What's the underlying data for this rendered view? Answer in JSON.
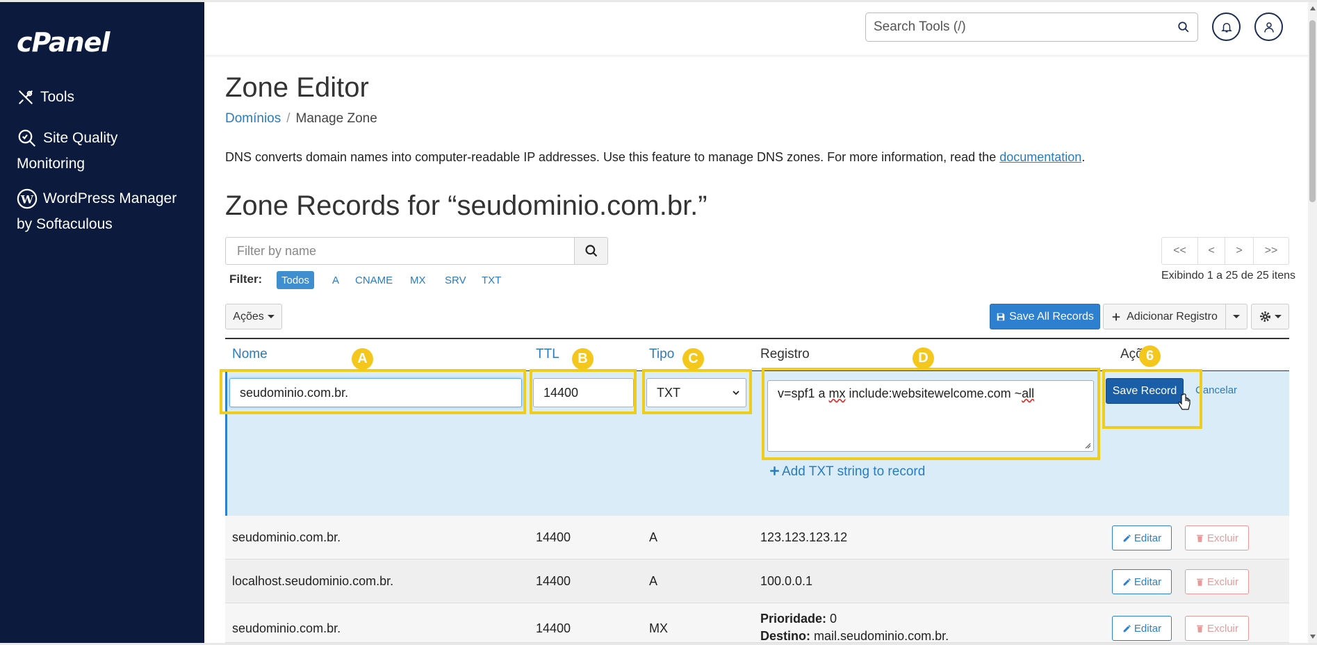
{
  "sidebar": {
    "logo": "cPanel",
    "items": [
      {
        "label": "Tools",
        "icon": "tools-icon"
      },
      {
        "label_line1": "Site Quality",
        "label_line2": "Monitoring",
        "icon": "magnifier-icon"
      },
      {
        "label_line1": "WordPress Manager",
        "label_line2": "by Softaculous",
        "icon": "wordpress-icon"
      }
    ]
  },
  "header": {
    "search_placeholder": "Search Tools (/)"
  },
  "main": {
    "page_title": "Zone Editor",
    "breadcrumb": {
      "link": "Domínios",
      "current": "Manage Zone"
    },
    "description": "DNS converts domain names into computer-readable IP addresses. Use this feature to manage DNS zones. For more information, read the ",
    "description_link": "documentation",
    "description_end": ".",
    "zone_title": "Zone Records for “seudominio.com.br.”",
    "filter_placeholder": "Filter by name",
    "pager": [
      "<<",
      "<",
      ">",
      ">>"
    ],
    "showing": "Exibindo 1 a 25 de 25 itens",
    "filter_label": "Filter:",
    "filter_tags": [
      "Todos",
      "A",
      "CNAME",
      "MX",
      "SRV",
      "TXT"
    ],
    "actions_label": "Ações",
    "save_all_label": "Save All Records",
    "add_record_label": "Adicionar Registro"
  },
  "table": {
    "headers": {
      "name": "Nome",
      "ttl": "TTL",
      "type": "Tipo",
      "record": "Registro",
      "actions": "Açõ"
    },
    "edit_row": {
      "name": "seudominio.com.br.",
      "ttl": "14400",
      "type": "TXT",
      "record_pre": "v=spf1 a ",
      "record_mx": "mx",
      "record_mid": " include:websitewelcome.com ~",
      "record_all": "all",
      "add_txt": "Add TXT string to record",
      "save_label": "Save Record",
      "cancel_label": "Cancelar"
    },
    "rows": [
      {
        "name": "seudominio.com.br.",
        "ttl": "14400",
        "type": "A",
        "record": "123.123.123.12"
      },
      {
        "name": "localhost.seudominio.com.br.",
        "ttl": "14400",
        "type": "A",
        "record": "100.0.0.1"
      },
      {
        "name": "seudominio.com.br.",
        "ttl": "14400",
        "type": "MX",
        "priority_label": "Prioridade:",
        "priority": "0",
        "dest_label": "Destino:",
        "dest": "mail.seudominio.com.br."
      }
    ],
    "edit_label": "Editar",
    "delete_label": "Excluir"
  },
  "annotations": {
    "a": "A",
    "b": "B",
    "c": "C",
    "d": "D",
    "e": "6",
    "color": "#f0cd1a"
  }
}
